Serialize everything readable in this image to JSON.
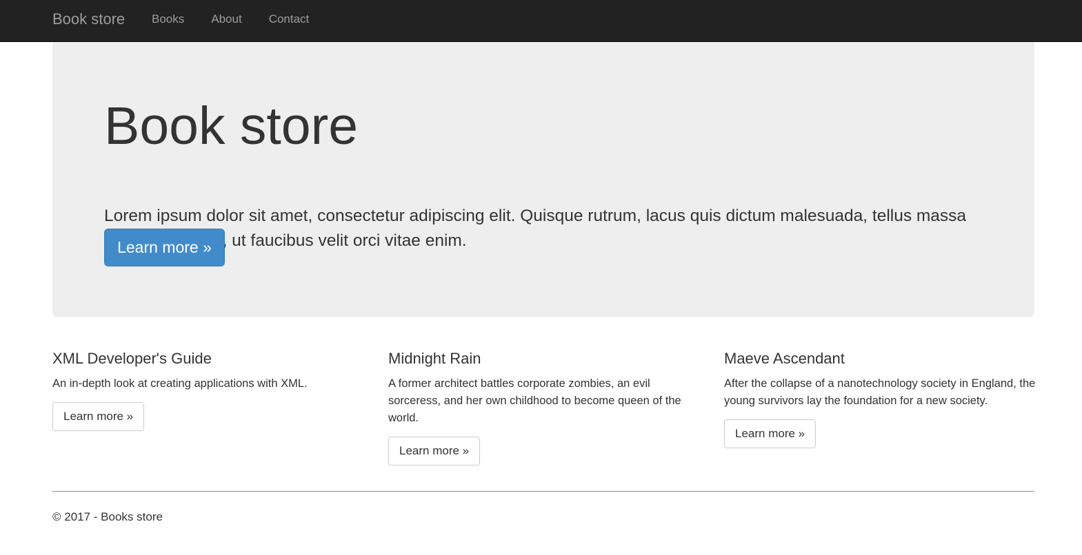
{
  "navbar": {
    "brand": "Book store",
    "links": [
      "Books",
      "About",
      "Contact"
    ]
  },
  "hero": {
    "title": "Book store",
    "lead": "Lorem ipsum dolor sit amet, consectetur adipiscing elit. Quisque rutrum, lacus quis dictum malesuada, tellus massa imperdiet lectus, ut faucibus velit orci vitae enim.",
    "button_label": "Learn more »"
  },
  "books": [
    {
      "title": "XML Developer's Guide",
      "description": "An in-depth look at creating applications with XML.",
      "button_label": "Learn more »"
    },
    {
      "title": "Midnight Rain",
      "description": "A former architect battles corporate zombies, an evil sorceress, and her own childhood to become queen of the world.",
      "button_label": "Learn more »"
    },
    {
      "title": "Maeve Ascendant",
      "description": "After the collapse of a nanotechnology society in England, the young survivors lay the foundation for a new society.",
      "button_label": "Learn more »"
    }
  ],
  "footer": {
    "text": "© 2017 - Books store"
  },
  "colors": {
    "navbar_bg": "#222222",
    "jumbotron_bg": "#eeeeee",
    "primary": "#428bca"
  }
}
